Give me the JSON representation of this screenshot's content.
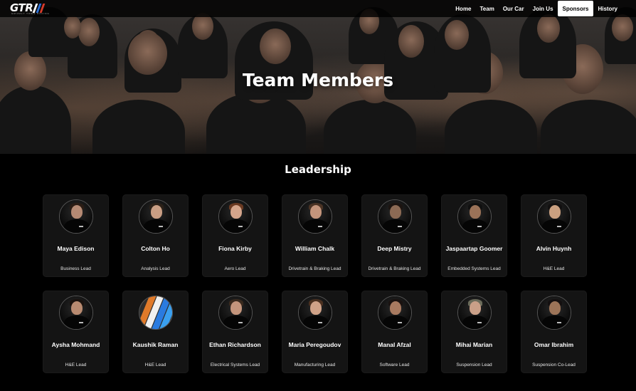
{
  "colors": {
    "page_bg": "#000000",
    "card_bg": "#141414",
    "logo_bar_blue": "#2a6fd6",
    "logo_bar_red": "#d63a2a",
    "nav_active_bg": "#ffffff"
  },
  "header": {
    "logo": {
      "text": "GTR",
      "subtext": "GRIZZLY TOWN RACING",
      "icon": "gtr-logo"
    },
    "nav": [
      {
        "label": "Home",
        "active": false
      },
      {
        "label": "Team",
        "active": false
      },
      {
        "label": "Our Car",
        "active": false
      },
      {
        "label": "Join Us",
        "active": false
      },
      {
        "label": "Sponsors",
        "active": true
      },
      {
        "label": "History",
        "active": false
      }
    ]
  },
  "hero": {
    "title": "Team Members"
  },
  "leadership": {
    "title": "Leadership",
    "members": [
      {
        "name": "Maya Edison",
        "role": "Business Lead",
        "skin": "#b58a74",
        "hair": "#2a1c14"
      },
      {
        "name": "Colton Ho",
        "role": "Analysis Lead",
        "skin": "#c99e84",
        "hair": "#2b2118"
      },
      {
        "name": "Fiona Kirby",
        "role": "Aero Lead",
        "skin": "#d4a58c",
        "hair": "#6a3a22"
      },
      {
        "name": "William Chalk",
        "role": "Drivetrain & Braking Lead",
        "skin": "#c4957c",
        "hair": "#4a3324"
      },
      {
        "name": "Deep Mistry",
        "role": "Drivetrain & Braking Lead",
        "skin": "#8c6a54",
        "hair": "#1c1410"
      },
      {
        "name": "Jaspaartap Goomer",
        "role": "Embedded Systems Lead",
        "skin": "#9a7258",
        "hair": "#101010"
      },
      {
        "name": "Alvin Huynh",
        "role": "H&E Lead",
        "skin": "#caa080",
        "hair": "#121010"
      },
      {
        "name": "Aysha Mohmand",
        "role": "H&E Lead",
        "skin": "#b88a70",
        "hair": "#1a120e"
      },
      {
        "name": "Kaushik Raman",
        "role": "H&E Lead",
        "placeholder": true
      },
      {
        "name": "Ethan Richardson",
        "role": "Electrical Systems Lead",
        "skin": "#c4957c",
        "hair": "#3a2a1e"
      },
      {
        "name": "Maria Peregoudov",
        "role": "Manufacturing Lead",
        "skin": "#d0a288",
        "hair": "#4a3020"
      },
      {
        "name": "Manal Afzal",
        "role": "Software Lead",
        "skin": "#a87a60",
        "hair": "#1a1210"
      },
      {
        "name": "Mihai Marian",
        "role": "Suspension Lead",
        "skin": "#caa088",
        "hair": "#6b6b5a"
      },
      {
        "name": "Omar Ibrahim",
        "role": "Suspension Co-Lead",
        "skin": "#9c7458",
        "hair": "#141010"
      }
    ],
    "placeholder_stripes": [
      "#e07a2a",
      "#f0f0f0",
      "#2a7be0",
      "#3aa0f0"
    ]
  }
}
